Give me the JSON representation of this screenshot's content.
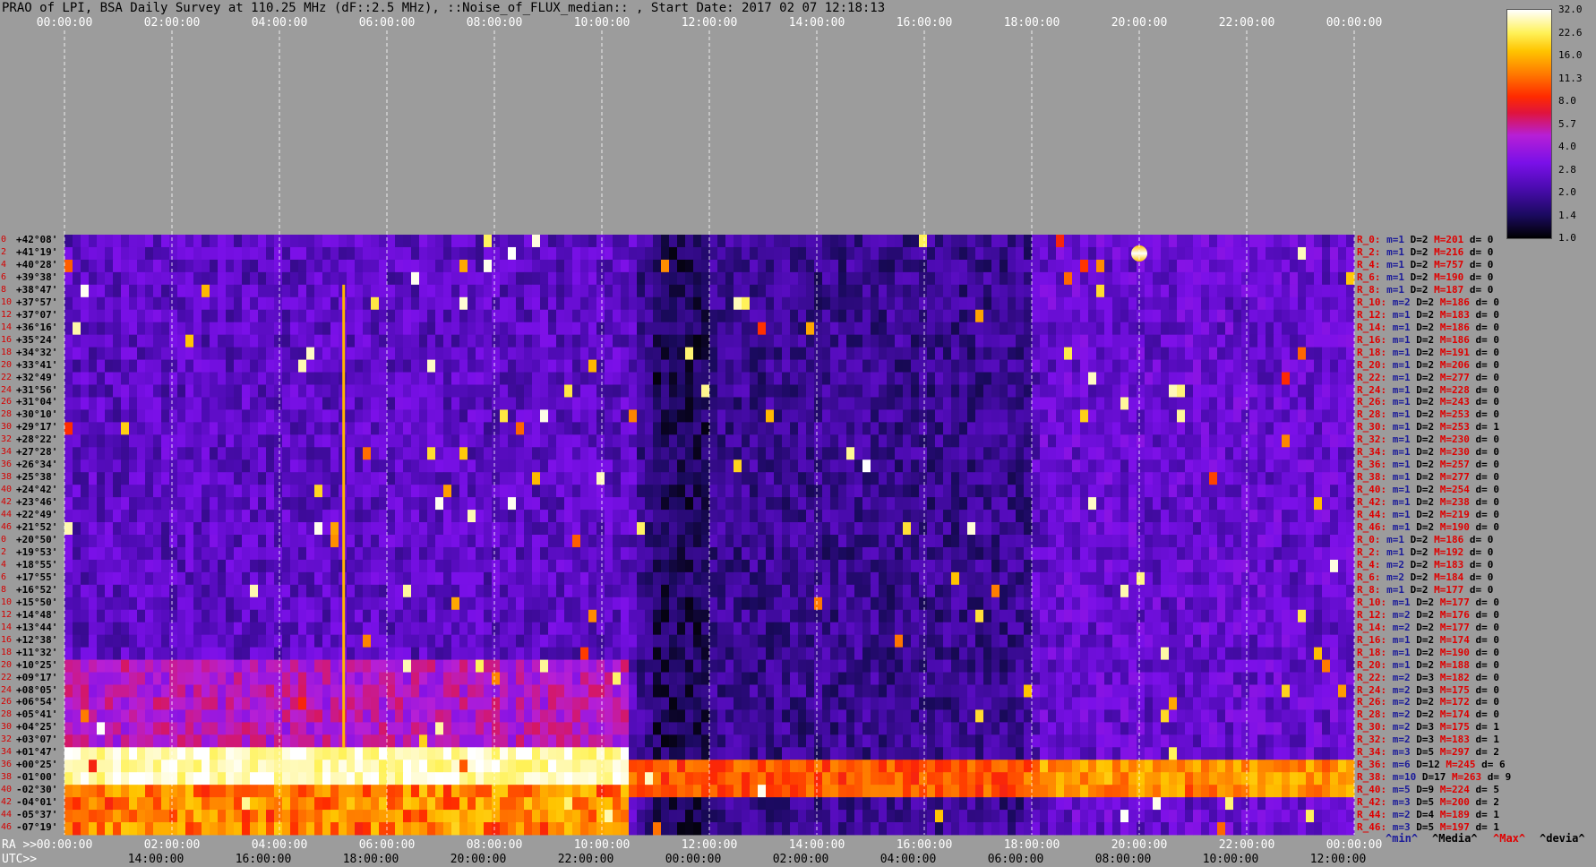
{
  "title": "PRAO of LPI, BSA Daily Survey at 110.25 MHz (dF::2.5 MHz), ::Noise_of_FLUX_median:: , Start Date: 2017 02 07 12:18:13",
  "top_axis_labels": [
    "00:00:00",
    "02:00:00",
    "04:00:00",
    "06:00:00",
    "08:00:00",
    "10:00:00",
    "12:00:00",
    "14:00:00",
    "16:00:00",
    "18:00:00",
    "20:00:00",
    "22:00:00",
    "00:00:00"
  ],
  "ra_axis_labels": [
    "00:00:00",
    "02:00:00",
    "04:00:00",
    "06:00:00",
    "08:00:00",
    "10:00:00",
    "12:00:00",
    "14:00:00",
    "16:00:00",
    "18:00:00",
    "20:00:00",
    "22:00:00",
    "00:00:00"
  ],
  "utc_axis_labels": [
    "14:00:00",
    "16:00:00",
    "18:00:00",
    "20:00:00",
    "22:00:00",
    "00:00:00",
    "02:00:00",
    "04:00:00",
    "06:00:00",
    "08:00:00",
    "10:00:00",
    "12:00:00"
  ],
  "footer": {
    "ra_prefix": "RA >>",
    "utc_prefix": "UTC>>"
  },
  "legend": [
    {
      "text": "^min^",
      "color": "#1a1a9a"
    },
    {
      "text": "^Media^",
      "color": "#000000"
    },
    {
      "text": "^Max^",
      "color": "#e00000"
    },
    {
      "text": "^devia^",
      "color": "#000000"
    }
  ],
  "colorbar": {
    "ticks": [
      "32.0",
      "22.6",
      "16.0",
      "11.3",
      "8.0",
      "5.7",
      "4.0",
      "2.8",
      "2.0",
      "1.4",
      "1.0"
    ]
  },
  "rows": [
    {
      "idx": "0",
      "dec": "+42°08'"
    },
    {
      "idx": "2",
      "dec": "+41°19'"
    },
    {
      "idx": "4",
      "dec": "+40°28'"
    },
    {
      "idx": "6",
      "dec": "+39°38'"
    },
    {
      "idx": "8",
      "dec": "+38°47'"
    },
    {
      "idx": "10",
      "dec": "+37°57'"
    },
    {
      "idx": "12",
      "dec": "+37°07'"
    },
    {
      "idx": "14",
      "dec": "+36°16'"
    },
    {
      "idx": "16",
      "dec": "+35°24'"
    },
    {
      "idx": "18",
      "dec": "+34°32'"
    },
    {
      "idx": "20",
      "dec": "+33°41'"
    },
    {
      "idx": "22",
      "dec": "+32°49'"
    },
    {
      "idx": "24",
      "dec": "+31°56'"
    },
    {
      "idx": "26",
      "dec": "+31°04'"
    },
    {
      "idx": "28",
      "dec": "+30°10'"
    },
    {
      "idx": "30",
      "dec": "+29°17'"
    },
    {
      "idx": "32",
      "dec": "+28°22'"
    },
    {
      "idx": "34",
      "dec": "+27°28'"
    },
    {
      "idx": "36",
      "dec": "+26°34'"
    },
    {
      "idx": "38",
      "dec": "+25°38'"
    },
    {
      "idx": "40",
      "dec": "+24°42'"
    },
    {
      "idx": "42",
      "dec": "+23°46'"
    },
    {
      "idx": "44",
      "dec": "+22°49'"
    },
    {
      "idx": "46",
      "dec": "+21°52'"
    },
    {
      "idx": "0",
      "dec": "+20°50'"
    },
    {
      "idx": "2",
      "dec": "+19°53'"
    },
    {
      "idx": "4",
      "dec": "+18°55'"
    },
    {
      "idx": "6",
      "dec": "+17°55'"
    },
    {
      "idx": "8",
      "dec": "+16°52'"
    },
    {
      "idx": "10",
      "dec": "+15°50'"
    },
    {
      "idx": "12",
      "dec": "+14°48'"
    },
    {
      "idx": "14",
      "dec": "+13°44'"
    },
    {
      "idx": "16",
      "dec": "+12°38'"
    },
    {
      "idx": "18",
      "dec": "+11°32'"
    },
    {
      "idx": "20",
      "dec": "+10°25'"
    },
    {
      "idx": "22",
      "dec": "+09°17'"
    },
    {
      "idx": "24",
      "dec": "+08°05'"
    },
    {
      "idx": "26",
      "dec": "+06°54'"
    },
    {
      "idx": "28",
      "dec": "+05°41'"
    },
    {
      "idx": "30",
      "dec": "+04°25'"
    },
    {
      "idx": "32",
      "dec": "+03°07'"
    },
    {
      "idx": "34",
      "dec": "+01°47'"
    },
    {
      "idx": "36",
      "dec": "+00°25'"
    },
    {
      "idx": "38",
      "dec": "-01°00'"
    },
    {
      "idx": "40",
      "dec": "-02°30'"
    },
    {
      "idx": "42",
      "dec": "-04°01'"
    },
    {
      "idx": "44",
      "dec": "-05°37'"
    },
    {
      "idx": "46",
      "dec": "-07°19'"
    }
  ],
  "stats": [
    {
      "name": "R_0:",
      "m": "m=1",
      "D": "D=2",
      "M": "M=201",
      "d": "d= 0"
    },
    {
      "name": "R_2:",
      "m": "m=1",
      "D": "D=2",
      "M": "M=216",
      "d": "d= 0"
    },
    {
      "name": "R_4:",
      "m": "m=1",
      "D": "D=2",
      "M": "M=757",
      "d": "d= 0"
    },
    {
      "name": "R_6:",
      "m": "m=1",
      "D": "D=2",
      "M": "M=190",
      "d": "d= 0"
    },
    {
      "name": "R_8:",
      "m": "m=1",
      "D": "D=2",
      "M": "M=187",
      "d": "d= 0"
    },
    {
      "name": "R_10:",
      "m": "m=2",
      "D": "D=2",
      "M": "M=186",
      "d": "d= 0"
    },
    {
      "name": "R_12:",
      "m": "m=1",
      "D": "D=2",
      "M": "M=183",
      "d": "d= 0"
    },
    {
      "name": "R_14:",
      "m": "m=1",
      "D": "D=2",
      "M": "M=186",
      "d": "d= 0"
    },
    {
      "name": "R_16:",
      "m": "m=1",
      "D": "D=2",
      "M": "M=186",
      "d": "d= 0"
    },
    {
      "name": "R_18:",
      "m": "m=1",
      "D": "D=2",
      "M": "M=191",
      "d": "d= 0"
    },
    {
      "name": "R_20:",
      "m": "m=1",
      "D": "D=2",
      "M": "M=206",
      "d": "d= 0"
    },
    {
      "name": "R_22:",
      "m": "m=1",
      "D": "D=2",
      "M": "M=277",
      "d": "d= 0"
    },
    {
      "name": "R_24:",
      "m": "m=1",
      "D": "D=2",
      "M": "M=228",
      "d": "d= 0"
    },
    {
      "name": "R_26:",
      "m": "m=1",
      "D": "D=2",
      "M": "M=243",
      "d": "d= 0"
    },
    {
      "name": "R_28:",
      "m": "m=1",
      "D": "D=2",
      "M": "M=253",
      "d": "d= 0"
    },
    {
      "name": "R_30:",
      "m": "m=1",
      "D": "D=2",
      "M": "M=253",
      "d": "d= 1"
    },
    {
      "name": "R_32:",
      "m": "m=1",
      "D": "D=2",
      "M": "M=230",
      "d": "d= 0"
    },
    {
      "name": "R_34:",
      "m": "m=1",
      "D": "D=2",
      "M": "M=230",
      "d": "d= 0"
    },
    {
      "name": "R_36:",
      "m": "m=1",
      "D": "D=2",
      "M": "M=257",
      "d": "d= 0"
    },
    {
      "name": "R_38:",
      "m": "m=1",
      "D": "D=2",
      "M": "M=277",
      "d": "d= 0"
    },
    {
      "name": "R_40:",
      "m": "m=1",
      "D": "D=2",
      "M": "M=254",
      "d": "d= 0"
    },
    {
      "name": "R_42:",
      "m": "m=1",
      "D": "D=2",
      "M": "M=238",
      "d": "d= 0"
    },
    {
      "name": "R_44:",
      "m": "m=1",
      "D": "D=2",
      "M": "M=219",
      "d": "d= 0"
    },
    {
      "name": "R_46:",
      "m": "m=1",
      "D": "D=2",
      "M": "M=190",
      "d": "d= 0"
    },
    {
      "name": "R_0:",
      "m": "m=1",
      "D": "D=2",
      "M": "M=186",
      "d": "d= 0"
    },
    {
      "name": "R_2:",
      "m": "m=1",
      "D": "D=2",
      "M": "M=192",
      "d": "d= 0"
    },
    {
      "name": "R_4:",
      "m": "m=2",
      "D": "D=2",
      "M": "M=183",
      "d": "d= 0"
    },
    {
      "name": "R_6:",
      "m": "m=2",
      "D": "D=2",
      "M": "M=184",
      "d": "d= 0"
    },
    {
      "name": "R_8:",
      "m": "m=1",
      "D": "D=2",
      "M": "M=177",
      "d": "d= 0"
    },
    {
      "name": "R_10:",
      "m": "m=1",
      "D": "D=2",
      "M": "M=177",
      "d": "d= 0"
    },
    {
      "name": "R_12:",
      "m": "m=2",
      "D": "D=2",
      "M": "M=176",
      "d": "d= 0"
    },
    {
      "name": "R_14:",
      "m": "m=2",
      "D": "D=2",
      "M": "M=177",
      "d": "d= 0"
    },
    {
      "name": "R_16:",
      "m": "m=1",
      "D": "D=2",
      "M": "M=174",
      "d": "d= 0"
    },
    {
      "name": "R_18:",
      "m": "m=1",
      "D": "D=2",
      "M": "M=190",
      "d": "d= 0"
    },
    {
      "name": "R_20:",
      "m": "m=1",
      "D": "D=2",
      "M": "M=188",
      "d": "d= 0"
    },
    {
      "name": "R_22:",
      "m": "m=2",
      "D": "D=3",
      "M": "M=182",
      "d": "d= 0"
    },
    {
      "name": "R_24:",
      "m": "m=2",
      "D": "D=3",
      "M": "M=175",
      "d": "d= 0"
    },
    {
      "name": "R_26:",
      "m": "m=2",
      "D": "D=2",
      "M": "M=172",
      "d": "d= 0"
    },
    {
      "name": "R_28:",
      "m": "m=2",
      "D": "D=2",
      "M": "M=174",
      "d": "d= 0"
    },
    {
      "name": "R_30:",
      "m": "m=2",
      "D": "D=3",
      "M": "M=175",
      "d": "d= 1"
    },
    {
      "name": "R_32:",
      "m": "m=2",
      "D": "D=3",
      "M": "M=183",
      "d": "d= 1"
    },
    {
      "name": "R_34:",
      "m": "m=3",
      "D": "D=5",
      "M": "M=297",
      "d": "d= 2"
    },
    {
      "name": "R_36:",
      "m": "m=6",
      "D": "D=12",
      "M": "M=245",
      "d": "d= 6"
    },
    {
      "name": "R_38:",
      "m": "m=10",
      "D": "D=17",
      "M": "M=263",
      "d": "d= 9"
    },
    {
      "name": "R_40:",
      "m": "m=5",
      "D": "D=9",
      "M": "M=224",
      "d": "d= 5"
    },
    {
      "name": "R_42:",
      "m": "m=3",
      "D": "D=5",
      "M": "M=200",
      "d": "d= 2"
    },
    {
      "name": "R_44:",
      "m": "m=2",
      "D": "D=4",
      "M": "M=189",
      "d": "d= 1"
    },
    {
      "name": "R_46:",
      "m": "m=3",
      "D": "D=5",
      "M": "M=197",
      "d": "d= 1"
    }
  ],
  "chart_data": {
    "type": "heatmap",
    "title": "PRAO of LPI, BSA Daily Survey at 110.25 MHz (dF::2.5 MHz), ::Noise_of_FLUX_median:: , Start Date: 2017 02 07 12:18:13",
    "x_axis": "RA",
    "xlim": [
      "00:00:00",
      "24:00:00"
    ],
    "secondary_x_axis": "UTC",
    "y_axis": "declination",
    "ylim": [
      "+42°08'",
      "-07°19'"
    ],
    "color_scale": "log",
    "color_range": [
      1.0,
      32.0
    ],
    "colors": {
      "low": "#000000",
      "mid_low": "#4b0bb0",
      "mid": "#b61fd6",
      "high": "#ff2a00",
      "very_high": "#ffc400",
      "max": "#ffffff"
    },
    "rows": 48,
    "features": [
      {
        "description": "strong bright band",
        "dec_range": [
          "+01°47'",
          "-04°01'"
        ],
        "ra_range": [
          "00:00:00",
          "10:30:00"
        ],
        "level": 32
      },
      {
        "description": "bright band",
        "dec_range": [
          "+00°25'",
          "-02°30'"
        ],
        "ra_range": [
          "10:30:00",
          "24:00:00"
        ],
        "level": 12
      },
      {
        "description": "bright point source",
        "dec": "+41°19'",
        "ra": "20:00:00",
        "level": 32
      },
      {
        "description": "vertical bright streak",
        "dec_range": [
          "+38°47'",
          "+01°47'"
        ],
        "ra": "05:10:00",
        "level": 16
      }
    ]
  }
}
